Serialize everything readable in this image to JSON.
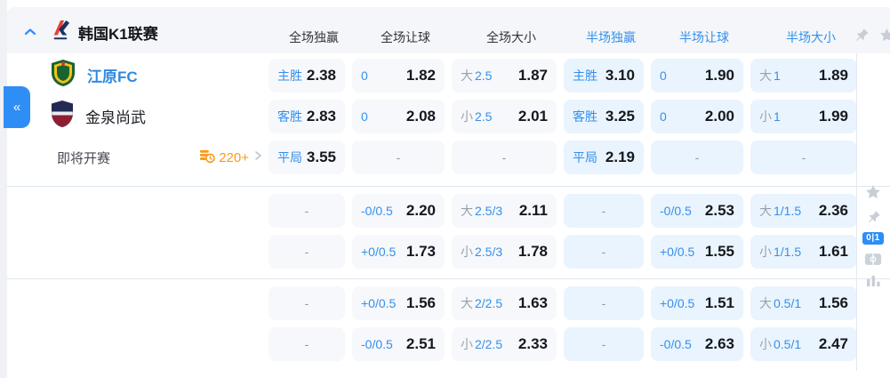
{
  "header": {
    "league_title": "韩国K1联赛",
    "columns": [
      {
        "label": "全场独赢"
      },
      {
        "label": "全场让球"
      },
      {
        "label": "全场大小"
      },
      {
        "label": "半场独赢"
      },
      {
        "label": "半场让球"
      },
      {
        "label": "半场大小"
      }
    ]
  },
  "left_tab": {
    "label": "«"
  },
  "match": {
    "home": {
      "name": "江原FC"
    },
    "away": {
      "name": "金泉尚武"
    },
    "status": "即将开赛",
    "extra_markets": "220+"
  },
  "rail": {
    "score_badge": "0|1"
  },
  "odds": {
    "rows": [
      {
        "cells": [
          {
            "label": "主胜",
            "value": "2.38"
          },
          {
            "label": "0",
            "value": "1.82"
          },
          {
            "prefix": "大",
            "label": "2.5",
            "value": "1.87"
          },
          {
            "label": "主胜",
            "value": "3.10"
          },
          {
            "label": "0",
            "value": "1.90"
          },
          {
            "prefix": "大",
            "label": "1",
            "value": "1.89"
          }
        ]
      },
      {
        "cells": [
          {
            "label": "客胜",
            "value": "2.83"
          },
          {
            "label": "0",
            "value": "2.08"
          },
          {
            "prefix": "小",
            "label": "2.5",
            "value": "2.01"
          },
          {
            "label": "客胜",
            "value": "3.25"
          },
          {
            "label": "0",
            "value": "2.00"
          },
          {
            "prefix": "小",
            "label": "1",
            "value": "1.99"
          }
        ]
      },
      {
        "cells": [
          {
            "label": "平局",
            "value": "3.55"
          },
          {
            "value": "-"
          },
          {
            "value": "-"
          },
          {
            "label": "平局",
            "value": "2.19"
          },
          {
            "value": "-"
          },
          {
            "value": "-"
          }
        ]
      },
      {
        "cells": [
          {
            "value": "-"
          },
          {
            "label": "-0/0.5",
            "value": "2.20"
          },
          {
            "prefix": "大",
            "label": "2.5/3",
            "value": "2.11"
          },
          {
            "value": "-"
          },
          {
            "label": "-0/0.5",
            "value": "2.53"
          },
          {
            "prefix": "大",
            "label": "1/1.5",
            "value": "2.36"
          }
        ]
      },
      {
        "cells": [
          {
            "value": "-"
          },
          {
            "label": "+0/0.5",
            "value": "1.73"
          },
          {
            "prefix": "小",
            "label": "2.5/3",
            "value": "1.78"
          },
          {
            "value": "-"
          },
          {
            "label": "+0/0.5",
            "value": "1.55"
          },
          {
            "prefix": "小",
            "label": "1/1.5",
            "value": "1.61"
          }
        ]
      },
      {
        "cells": [
          {
            "value": "-"
          },
          {
            "label": "+0/0.5",
            "value": "1.56"
          },
          {
            "prefix": "大",
            "label": "2/2.5",
            "value": "1.63"
          },
          {
            "value": "-"
          },
          {
            "label": "+0/0.5",
            "value": "1.51"
          },
          {
            "prefix": "大",
            "label": "0.5/1",
            "value": "1.56"
          }
        ]
      },
      {
        "cells": [
          {
            "value": "-"
          },
          {
            "label": "-0/0.5",
            "value": "2.51"
          },
          {
            "prefix": "小",
            "label": "2/2.5",
            "value": "2.33"
          },
          {
            "value": "-"
          },
          {
            "label": "-0/0.5",
            "value": "2.63"
          },
          {
            "prefix": "小",
            "label": "0.5/1",
            "value": "2.47"
          }
        ]
      }
    ]
  },
  "colors": {
    "accent_blue": "#2f8ef5",
    "label_blue": "#3390ec",
    "half_cell_bg": "#eaf4fe",
    "full_cell_bg": "#f7f8fb",
    "orange": "#f79b1e"
  }
}
